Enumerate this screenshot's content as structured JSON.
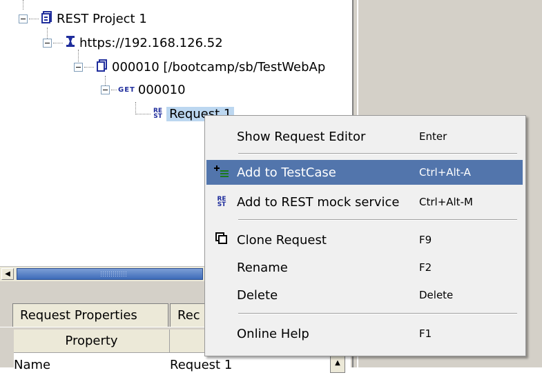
{
  "tree": {
    "project_label": "REST Project 1",
    "service_label": "https://192.168.126.52",
    "resource_label": "000010 [/bootcamp/sb/TestWebAp",
    "get_tag": "GET",
    "method_label": "000010",
    "rest_tag_top": "RE",
    "rest_tag_bottom": "ST",
    "request_label": "Request 1"
  },
  "context_menu": {
    "items": [
      {
        "label": "Show Request Editor",
        "shortcut": "Enter",
        "icon": ""
      },
      {
        "label": "Add to TestCase",
        "shortcut": "Ctrl+Alt-A",
        "icon": "add-to-testcase-icon"
      },
      {
        "label": "Add to REST mock service",
        "shortcut": "Ctrl+Alt-M",
        "icon": "rest-icon"
      },
      {
        "label": "Clone Request",
        "shortcut": "F9",
        "icon": "clone-icon"
      },
      {
        "label": "Rename",
        "shortcut": "F2",
        "icon": ""
      },
      {
        "label": "Delete",
        "shortcut": "Delete",
        "icon": ""
      },
      {
        "label": "Online Help",
        "shortcut": "F1",
        "icon": ""
      }
    ]
  },
  "bottom_panel": {
    "tabs": [
      "Request Properties",
      "Rec"
    ],
    "table": {
      "headers": [
        "Property",
        ""
      ],
      "rows": [
        [
          "Name",
          "Request 1"
        ]
      ]
    }
  },
  "colors": {
    "highlight": "#5275ac",
    "selection": "#bcd7f0",
    "tree_icon": "#1f2d9c"
  }
}
